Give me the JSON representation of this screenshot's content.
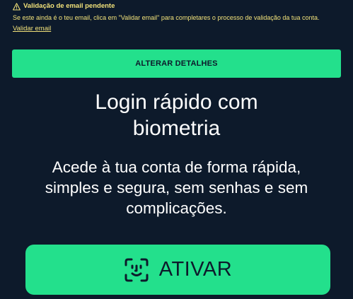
{
  "alert": {
    "icon": "warning-triangle-icon",
    "title": "Validação de email pendente",
    "message": "Se este ainda é o teu email, clica em \"Validar email\" para completares o processo de validação da tua conta.",
    "link_label": "Validar email",
    "color": "#f2e27a"
  },
  "details_button": {
    "label": "ALTERAR DETALHES"
  },
  "promo": {
    "title_line1": "Login rápido com",
    "title_line2": "biometria",
    "subtitle": "Acede à tua conta de forma rápida, simples e segura, sem senhas e sem complicações."
  },
  "activate_button": {
    "icon": "face-id-icon",
    "label": "ATIVAR"
  },
  "colors": {
    "background": "#0d1a2b",
    "accent": "#23e08c",
    "text": "#ffffff"
  }
}
